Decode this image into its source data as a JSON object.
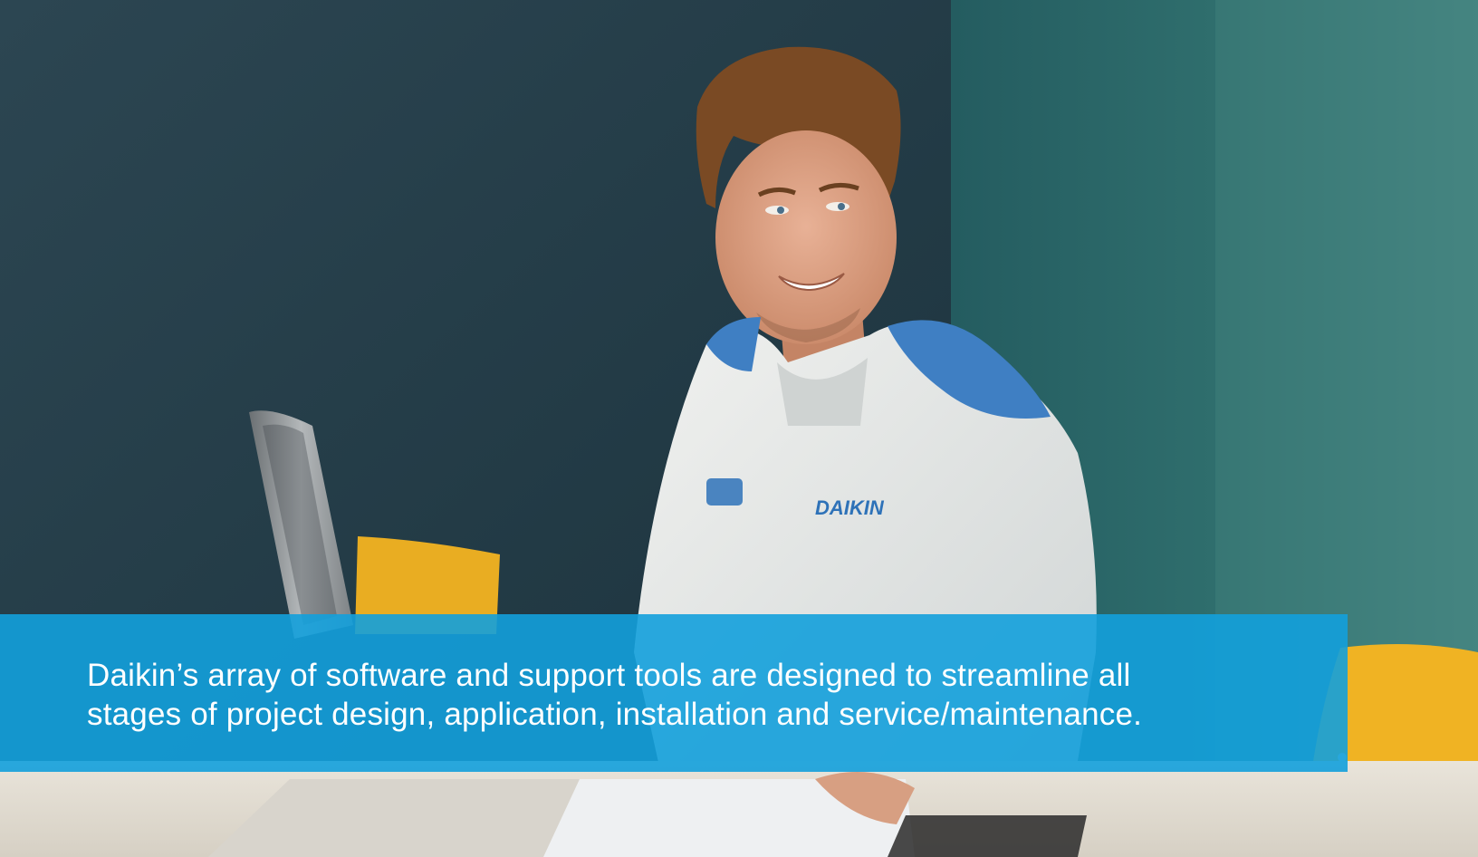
{
  "photo": {
    "subject": "technician-photo",
    "logo_text": "DAIKIN"
  },
  "caption": {
    "line1": "Daikin’s array of software and support tools are designed to streamline all",
    "line2": "stages of project design, application, installation and service/maintenance."
  },
  "colors": {
    "banner": "#13a0dc",
    "wall_dark": "#26404b",
    "wall_teal": "#2f6c6c",
    "chair_yellow": "#f0b323",
    "jacket_white": "#e6e8e6",
    "jacket_blue": "#3f7fc3"
  }
}
